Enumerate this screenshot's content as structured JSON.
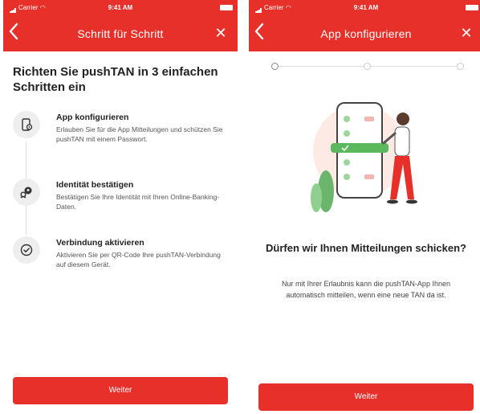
{
  "status_bar": {
    "carrier": "Carrier",
    "time": "9:41 AM"
  },
  "colors": {
    "brand_red": "#e8302a",
    "step_circle_bg": "#eeeeee",
    "illus_green": "#7bc67b"
  },
  "screen1": {
    "nav_title": "Schritt für Schritt",
    "back_icon": "chevron-left-icon",
    "close_icon": "close-icon",
    "heading": "Richten Sie pushTAN in 3 einfachen Schritten ein",
    "steps": [
      {
        "title": "App konfigurieren",
        "description": "Erlauben Sie für die App Mitteilungen und schützen Sie pushTAN mit einem Passwort.",
        "icon": "phone-settings-icon"
      },
      {
        "title": "Identität bestätigen",
        "description": "Bestätigen Sie Ihre Identität mit Ihren Online-Banking-Daten.",
        "icon": "user-key-icon"
      },
      {
        "title": "Verbindung aktivieren",
        "description": "Aktivieren Sie per QR-Code Ihre pushTAN-Verbindung auf diesem Gerät.",
        "icon": "check-circle-icon"
      }
    ],
    "button_label": "Weiter"
  },
  "screen2": {
    "nav_title": "App konfigurieren",
    "back_icon": "chevron-left-icon",
    "close_icon": "close-icon",
    "progress_steps": 3,
    "progress_current": 1,
    "question": "Dürfen wir Ihnen Mitteilungen schicken?",
    "description": "Nur mit Ihrer Erlaubnis kann die pushTAN-App Ihnen automatisch mitteilen, wenn eine neue TAN da ist.",
    "button_label": "Weiter"
  }
}
